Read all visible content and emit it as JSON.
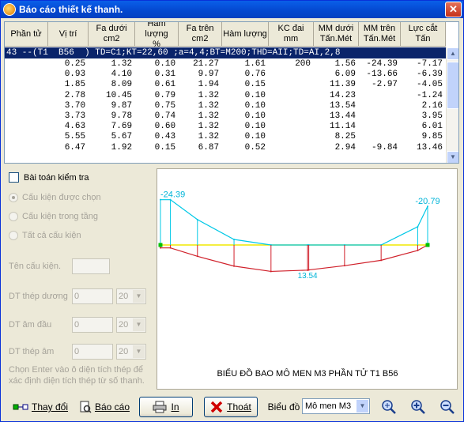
{
  "window": {
    "title": "Báo cáo thiết kế thanh.",
    "close": "✕"
  },
  "grid": {
    "columns": [
      {
        "l1": "Phần tử",
        "l2": ""
      },
      {
        "l1": "Vị trí",
        "l2": ""
      },
      {
        "l1": "Fa dưới",
        "l2": "cm2"
      },
      {
        "l1": "Hàm lượng",
        "l2": "%"
      },
      {
        "l1": "Fa trên",
        "l2": "cm2"
      },
      {
        "l1": "Hàm lượng",
        "l2": ""
      },
      {
        "l1": "KC đai",
        "l2": "mm"
      },
      {
        "l1": "MM dưới",
        "l2": "Tấn.Mét"
      },
      {
        "l1": "MM trên",
        "l2": "Tấn.Mét"
      },
      {
        "l1": "Lực cắt",
        "l2": "Tấn"
      }
    ],
    "selected_row": "43 --(T1  B56  ) TD=C1;KT=22,60 ;a=4,4;BT=M200;THD=AII;TD=AI,2,8",
    "rows": [
      [
        "",
        "0.25",
        "1.32",
        "0.10",
        "21.27",
        "1.61",
        "200",
        "1.56",
        "-24.39",
        "-7.17"
      ],
      [
        "",
        "0.93",
        "4.10",
        "0.31",
        "9.97",
        "0.76",
        "",
        "6.09",
        "-13.66",
        "-6.39"
      ],
      [
        "",
        "1.85",
        "8.09",
        "0.61",
        "1.94",
        "0.15",
        "",
        "11.39",
        "-2.97",
        "-4.05"
      ],
      [
        "",
        "2.78",
        "10.45",
        "0.79",
        "1.32",
        "0.10",
        "",
        "14.23",
        "",
        "-1.24"
      ],
      [
        "",
        "3.70",
        "9.87",
        "0.75",
        "1.32",
        "0.10",
        "",
        "13.54",
        "",
        "2.16"
      ],
      [
        "",
        "3.73",
        "9.78",
        "0.74",
        "1.32",
        "0.10",
        "",
        "13.44",
        "",
        "3.95"
      ],
      [
        "",
        "4.63",
        "7.69",
        "0.60",
        "1.32",
        "0.10",
        "",
        "11.14",
        "",
        "6.01"
      ],
      [
        "",
        "5.55",
        "5.67",
        "0.43",
        "1.32",
        "0.10",
        "",
        "8.25",
        "",
        "9.85"
      ],
      [
        "",
        "6.47",
        "1.92",
        "0.15",
        "6.87",
        "0.52",
        "",
        "2.94",
        "-9.84",
        "13.46"
      ]
    ]
  },
  "options": {
    "check_label": "Bài toán kiểm tra",
    "radio1": "Cấu kiện được chọn",
    "radio2": "Cấu kiện trong tầng",
    "radio3": "Tất cả cấu kiện",
    "ten_label": "Tên cấu kiện.",
    "dt_duong": "DT thép dương",
    "dt_dau": "DT âm đầu",
    "dt_am": "DT thép âm",
    "val0": "0",
    "val20": "20",
    "hint": "Chọn Enter vào ô diện tích thép để xác định diện tích thép từ số thanh."
  },
  "chart_data": {
    "type": "line",
    "title": "BIỂU ĐỒ BAO MÔ MEN M3 PHẦN TỬ T1  B56",
    "x": [
      0,
      0.25,
      0.93,
      1.85,
      2.78,
      3.7,
      3.73,
      4.63,
      5.55,
      6.47,
      6.72
    ],
    "series": [
      {
        "values": [
          -24.39,
          -24.39,
          -13.66,
          -2.97,
          0,
          0,
          0,
          0,
          0,
          -9.84,
          -20.79
        ],
        "color": "#00c8e6"
      },
      {
        "values": [
          1.56,
          1.56,
          6.09,
          11.39,
          14.23,
          13.54,
          13.44,
          11.14,
          8.25,
          2.94,
          0
        ],
        "color": "#d0202a"
      }
    ],
    "labels": {
      "left_top": "-24.39",
      "right_top": "-20.79",
      "bottom": "13.54"
    },
    "baseline_color": "#f0e800"
  },
  "toolbar": {
    "change": "Thay đổi",
    "report": "Báo cáo",
    "print": "In",
    "exit": "Thoát",
    "chart_label": "Biểu đồ",
    "chart_select": "Mô men M3"
  }
}
